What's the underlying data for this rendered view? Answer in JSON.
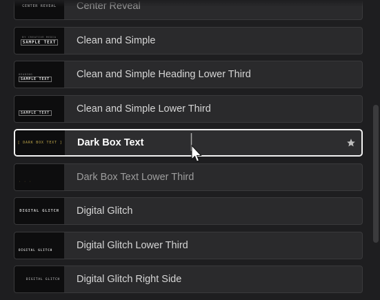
{
  "items": [
    {
      "label": "Center Reveal",
      "thumb": "CENTER REVEAL",
      "thumb_style": "center"
    },
    {
      "label": "Clean and Simple",
      "thumb_small": "BY CREATIVE MEDIA",
      "thumb": "SAMPLE TEXT",
      "thumb_style": "stacked"
    },
    {
      "label": "Clean and Simple Heading Lower Third",
      "thumb_small": "HEADING",
      "thumb": "SAMPLE TEXT",
      "thumb_style": "stacked-bottom"
    },
    {
      "label": "Clean and Simple Lower Third",
      "thumb": "SAMPLE TEXT",
      "thumb_style": "bottom-left"
    },
    {
      "label": "Dark Box Text",
      "thumb": "[ DARK BOX TEXT ]",
      "thumb_style": "center",
      "selected": true,
      "favorite_icon": "star-icon"
    },
    {
      "label": "Dark Box Text Lower Third",
      "thumb": "· · ·",
      "thumb_style": "bottom-left"
    },
    {
      "label": "Digital Glitch",
      "thumb": "DIGITAL GLITCH",
      "thumb_style": "center"
    },
    {
      "label": "Digital Glitch Lower Third",
      "thumb": "DIGITAL GLITCH",
      "thumb_style": "bottom-left"
    },
    {
      "label": "Digital Glitch Right Side",
      "thumb": "DIGITAL GLITCH",
      "thumb_style": "center"
    }
  ],
  "colors": {
    "background": "#1e1e20",
    "item_bg": "#2a2a2c",
    "selected_border": "#f2f2f2",
    "thumb_bg": "#0d0d0e"
  }
}
